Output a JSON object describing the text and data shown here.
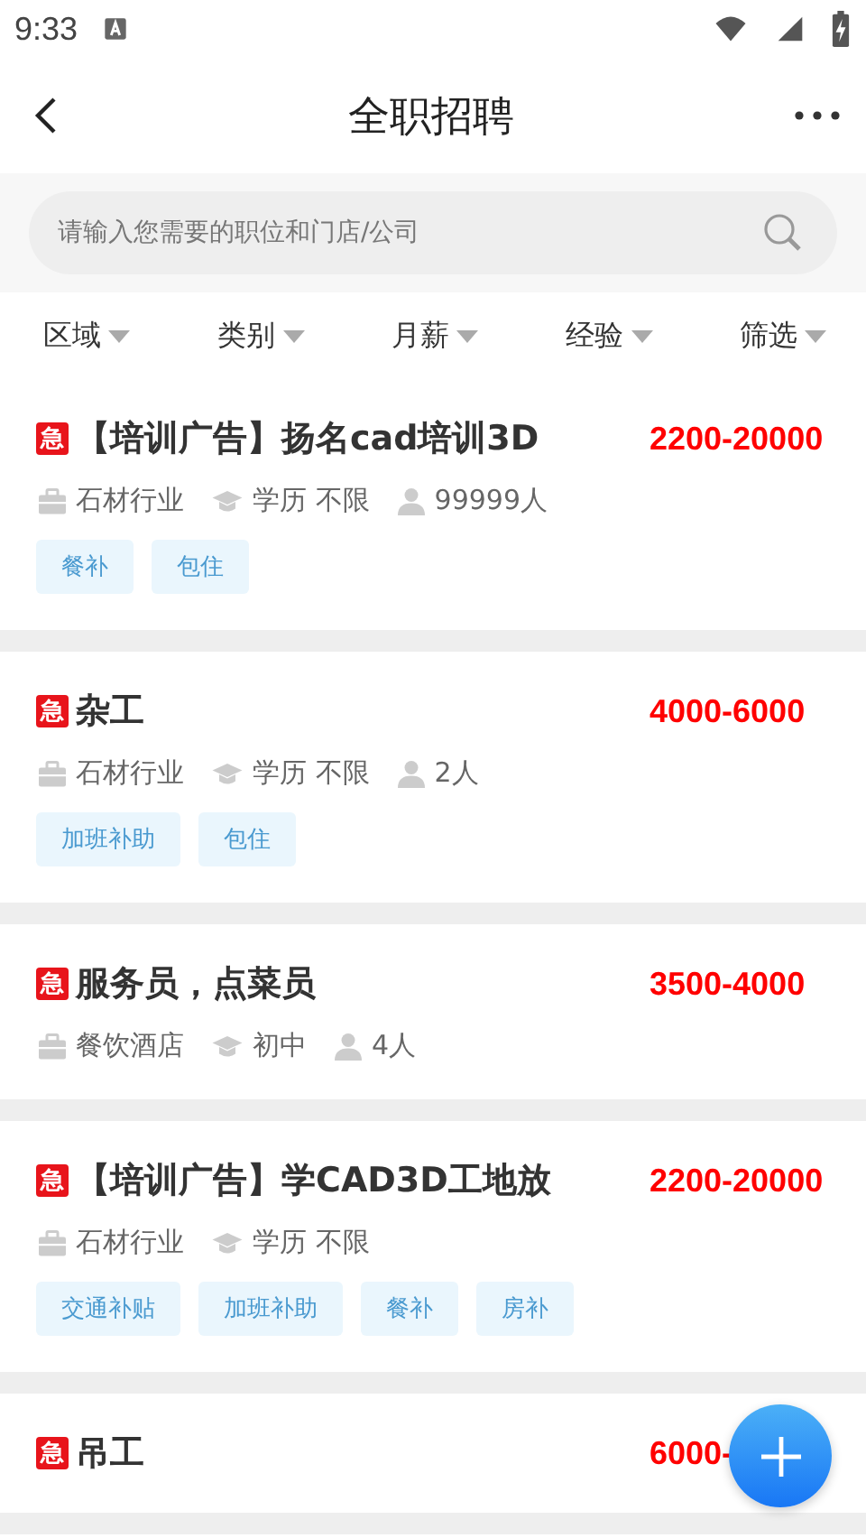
{
  "status_bar": {
    "time": "9:33"
  },
  "header": {
    "title": "全职招聘"
  },
  "search": {
    "placeholder": "请输入您需要的职位和门店/公司"
  },
  "filters": [
    {
      "label": "区域"
    },
    {
      "label": "类别"
    },
    {
      "label": "月薪"
    },
    {
      "label": "经验"
    },
    {
      "label": "筛选"
    }
  ],
  "jobs": [
    {
      "badge": "急",
      "title": "【培训广告】扬名cad培训3D",
      "salary": "2200-20000",
      "industry": "石材行业",
      "education": "学历 不限",
      "headcount": "99999人",
      "tags": [
        "餐补",
        "包住"
      ]
    },
    {
      "badge": "急",
      "title": "杂工",
      "salary": "4000-6000",
      "industry": "石材行业",
      "education": "学历 不限",
      "headcount": "2人",
      "tags": [
        "加班补助",
        "包住"
      ]
    },
    {
      "badge": "急",
      "title": "服务员，点菜员",
      "salary": "3500-4000",
      "industry": "餐饮酒店",
      "education": "初中",
      "headcount": "4人"
    },
    {
      "badge": "急",
      "title": "【培训广告】学CAD3D工地放",
      "salary": "2200-20000",
      "industry": "石材行业",
      "education": "学历 不限",
      "tags": [
        "交通补贴",
        "加班补助",
        "餐补",
        "房补"
      ]
    },
    {
      "badge": "急",
      "title": "吊工",
      "salary": "6000-"
    }
  ]
}
